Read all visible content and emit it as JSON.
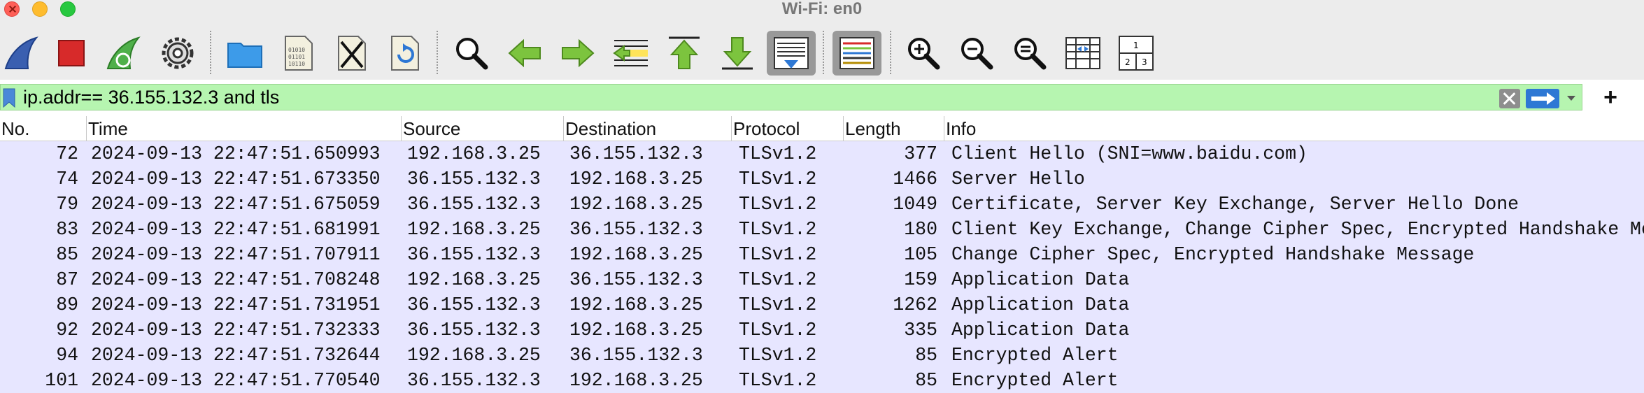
{
  "window": {
    "title": "Wi-Fi: en0"
  },
  "toolbar": {
    "buttons": [
      "start-capture",
      "stop-capture",
      "restart-capture",
      "capture-options",
      "open-file",
      "save-file",
      "close-file",
      "reload-file",
      "find-packet",
      "go-back",
      "go-forward",
      "go-to-packet",
      "go-first-packet",
      "go-last-packet",
      "auto-scroll",
      "colorize",
      "zoom-in",
      "zoom-out",
      "normal-size",
      "resize-columns",
      "layout"
    ],
    "layout_icon_labels": [
      "1",
      "2",
      "3"
    ]
  },
  "filter": {
    "value": "ip.addr== 36.155.132.3 and tls",
    "plus_label": "+"
  },
  "columns": [
    "No.",
    "Time",
    "Source",
    "Destination",
    "Protocol",
    "Length",
    "Info"
  ],
  "packets": [
    {
      "no": "72",
      "time": "2024-09-13 22:47:51.650993",
      "source": "192.168.3.25",
      "destination": "36.155.132.3",
      "protocol": "TLSv1.2",
      "length": "377",
      "info": "Client Hello (SNI=www.baidu.com)"
    },
    {
      "no": "74",
      "time": "2024-09-13 22:47:51.673350",
      "source": "36.155.132.3",
      "destination": "192.168.3.25",
      "protocol": "TLSv1.2",
      "length": "1466",
      "info": "Server Hello"
    },
    {
      "no": "79",
      "time": "2024-09-13 22:47:51.675059",
      "source": "36.155.132.3",
      "destination": "192.168.3.25",
      "protocol": "TLSv1.2",
      "length": "1049",
      "info": "Certificate, Server Key Exchange, Server Hello Done"
    },
    {
      "no": "83",
      "time": "2024-09-13 22:47:51.681991",
      "source": "192.168.3.25",
      "destination": "36.155.132.3",
      "protocol": "TLSv1.2",
      "length": "180",
      "info": "Client Key Exchange, Change Cipher Spec, Encrypted Handshake Message"
    },
    {
      "no": "85",
      "time": "2024-09-13 22:47:51.707911",
      "source": "36.155.132.3",
      "destination": "192.168.3.25",
      "protocol": "TLSv1.2",
      "length": "105",
      "info": "Change Cipher Spec, Encrypted Handshake Message"
    },
    {
      "no": "87",
      "time": "2024-09-13 22:47:51.708248",
      "source": "192.168.3.25",
      "destination": "36.155.132.3",
      "protocol": "TLSv1.2",
      "length": "159",
      "info": "Application Data"
    },
    {
      "no": "89",
      "time": "2024-09-13 22:47:51.731951",
      "source": "36.155.132.3",
      "destination": "192.168.3.25",
      "protocol": "TLSv1.2",
      "length": "1262",
      "info": "Application Data"
    },
    {
      "no": "92",
      "time": "2024-09-13 22:47:51.732333",
      "source": "36.155.132.3",
      "destination": "192.168.3.25",
      "protocol": "TLSv1.2",
      "length": "335",
      "info": "Application Data"
    },
    {
      "no": "94",
      "time": "2024-09-13 22:47:51.732644",
      "source": "192.168.3.25",
      "destination": "36.155.132.3",
      "protocol": "TLSv1.2",
      "length": "85",
      "info": "Encrypted Alert"
    },
    {
      "no": "101",
      "time": "2024-09-13 22:47:51.770540",
      "source": "36.155.132.3",
      "destination": "192.168.3.25",
      "protocol": "TLSv1.2",
      "length": "85",
      "info": "Encrypted Alert"
    }
  ],
  "colors": {
    "filter_bg": "#b6f5b0",
    "row_bg": "#e7e6ff",
    "accent": "#2e78d4"
  }
}
